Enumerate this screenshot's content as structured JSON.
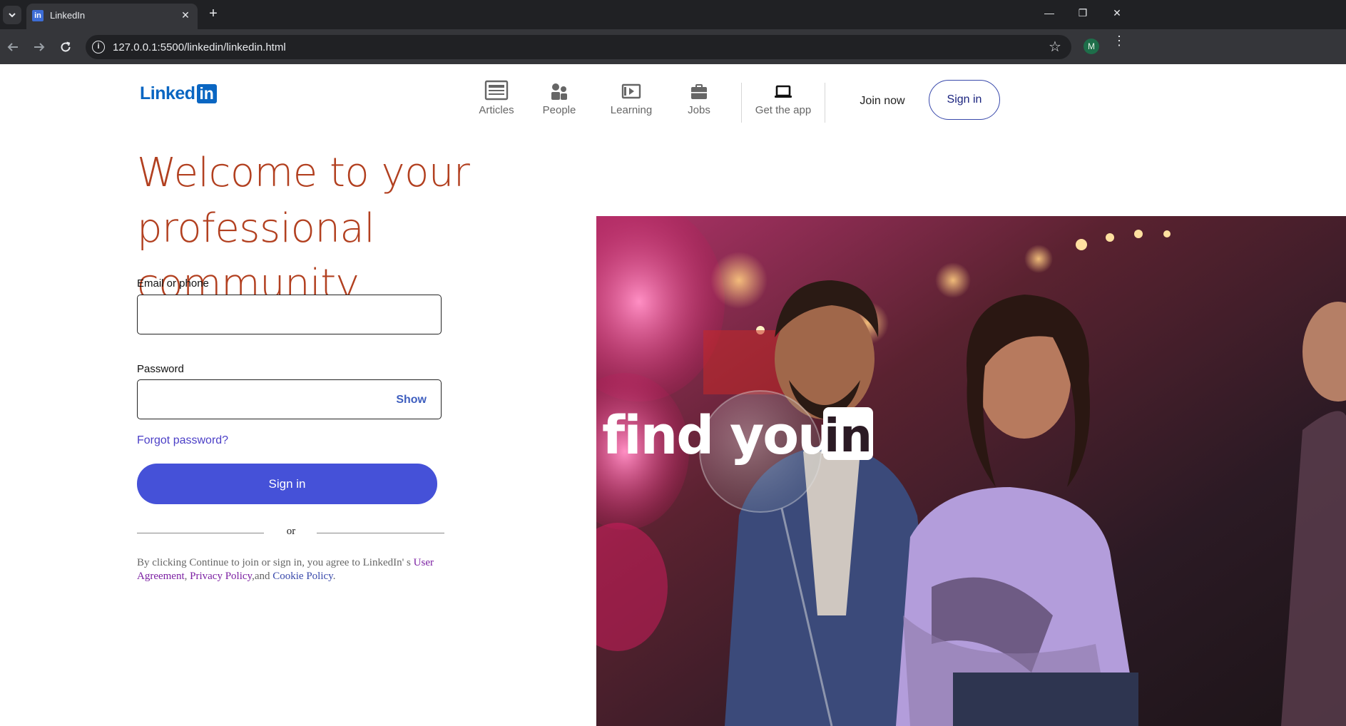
{
  "browser": {
    "tab_title": "LinkedIn",
    "url": "127.0.0.1:5500/linkedin/linkedin.html",
    "profile_initial": "M"
  },
  "header": {
    "logo_text": "Linked",
    "logo_box": "in",
    "nav": [
      {
        "label": "Articles",
        "icon": "articles-icon"
      },
      {
        "label": "People",
        "icon": "people-icon"
      },
      {
        "label": "Learning",
        "icon": "learning-icon"
      },
      {
        "label": "Jobs",
        "icon": "jobs-icon"
      },
      {
        "label": "Get the app",
        "icon": "laptop-icon"
      }
    ],
    "join_now": "Join now",
    "sign_in": "Sign in"
  },
  "hero": {
    "headline_line1": "Welcome to your",
    "headline_line2": "professional community",
    "image_text": "find your",
    "image_badge": "in"
  },
  "form": {
    "email_label": "Email or phone",
    "email_value": "",
    "password_label": "Password",
    "password_value": "",
    "show_label": "Show",
    "forgot_label": "Forgot password?",
    "signin_label": "Sign in",
    "or_label": "or"
  },
  "terms": {
    "prefix": "By clicking Continue to join or sign in, you agree to LinkedIn' s ",
    "user_agreement": "User Agreement",
    "sep1": ", ",
    "privacy_policy": "Privacy Policy",
    "sep2": ",and ",
    "cookie_policy": "Cookie Policy",
    "suffix": "."
  },
  "colors": {
    "headline": "#b24020",
    "brand_blue": "#0a66c2",
    "signin_button": "#4551d8",
    "link": "#4b3fc7"
  }
}
